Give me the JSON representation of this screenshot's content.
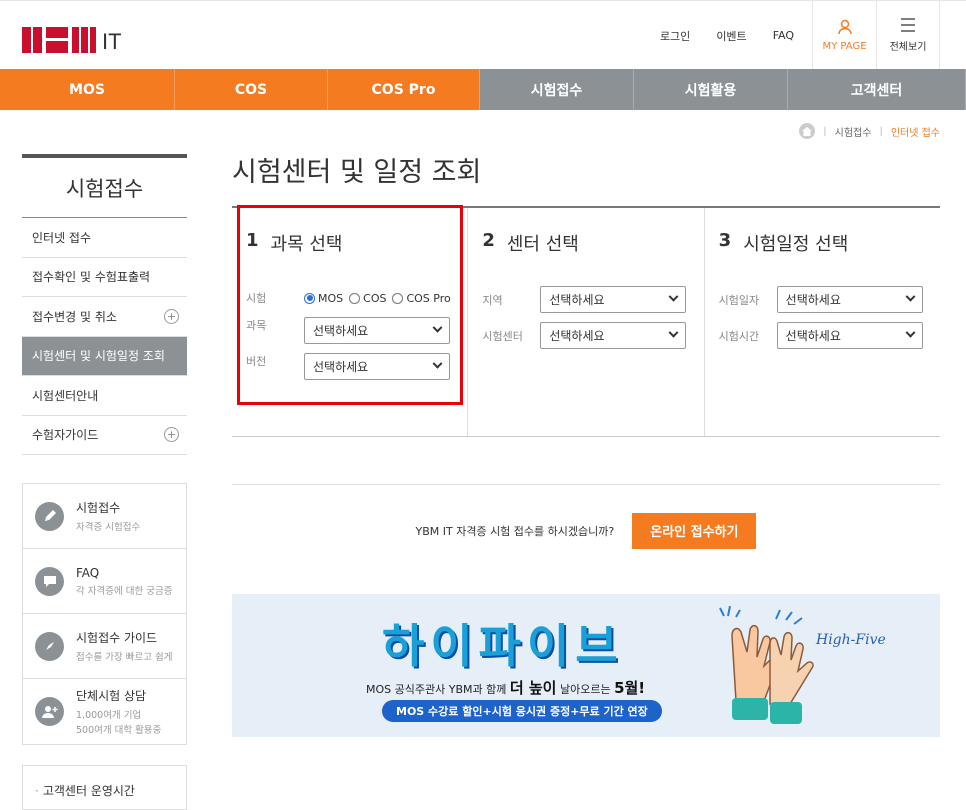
{
  "header": {
    "logo_text": "YBM",
    "logo_suffix": "IT",
    "util_links": [
      "로그인",
      "이벤트",
      "FAQ"
    ],
    "mypage_label": "MY PAGE",
    "menu_label": "전체보기"
  },
  "gnb": [
    "MOS",
    "COS",
    "COS Pro",
    "시험접수",
    "시험활용",
    "고객센터"
  ],
  "breadcrumb": {
    "sep": "|",
    "items": [
      "시험접수",
      "인터넷 접수"
    ]
  },
  "lnb": {
    "title": "시험접수",
    "items": [
      {
        "label": "인터넷 접수"
      },
      {
        "label": "접수확인 및 수험표출력"
      },
      {
        "label": "접수변경 및 취소",
        "expand": "+"
      },
      {
        "label": "시험센터 및 시험일정 조회"
      },
      {
        "label": "시험센터안내"
      },
      {
        "label": "수험자가이드",
        "expand": "+"
      }
    ]
  },
  "quick": [
    {
      "title": "시험접수",
      "sub": "자격증 시험접수"
    },
    {
      "title": "FAQ",
      "sub": "각 자격증에 대한 궁금증"
    },
    {
      "title": "시험접수 가이드",
      "sub": "접수를 가장 빠르고 쉽게"
    },
    {
      "title": "단체시험 상담",
      "sub": "1,000여개 기업",
      "sub2": "500여개 대학 활용중"
    }
  ],
  "hours": "고객센터 운영시간",
  "page_title": "시험센터 및 일정 조회",
  "steps": {
    "s1": {
      "num": "1",
      "title": "과목 선택",
      "exam_label": "시험",
      "radios": [
        "MOS",
        "COS",
        "COS Pro"
      ],
      "subject_label": "과목",
      "subject_value": "선택하세요",
      "version_label": "버전",
      "version_value": "선택하세요"
    },
    "s2": {
      "num": "2",
      "title": "센터 선택",
      "region_label": "지역",
      "region_value": "선택하세요",
      "center_label": "시험센터",
      "center_value": "선택하세요"
    },
    "s3": {
      "num": "3",
      "title": "시험일정 선택",
      "date_label": "시험일자",
      "date_value": "선택하세요",
      "time_label": "시험시간",
      "time_value": "선택하세요"
    }
  },
  "apply": {
    "text": "YBM IT 자격증 시험 접수를 하시겠습니까?",
    "button": "온라인 접수하기"
  },
  "banner": {
    "title": "하이파이브",
    "sub_pre": "MOS 공식주관사 YBM과 함께 ",
    "sub_bold": "더 높이",
    "sub_mid": " 날아오르는 ",
    "sub_end": "5월!",
    "pill": "MOS 수강료 할인+시험 응시권 증정+무료 기간 연장",
    "hf_text": "High-Five"
  },
  "colors": {
    "accent": "#f47b20",
    "gnb_gray": "#8c9196",
    "highlight": "#e8000b"
  }
}
